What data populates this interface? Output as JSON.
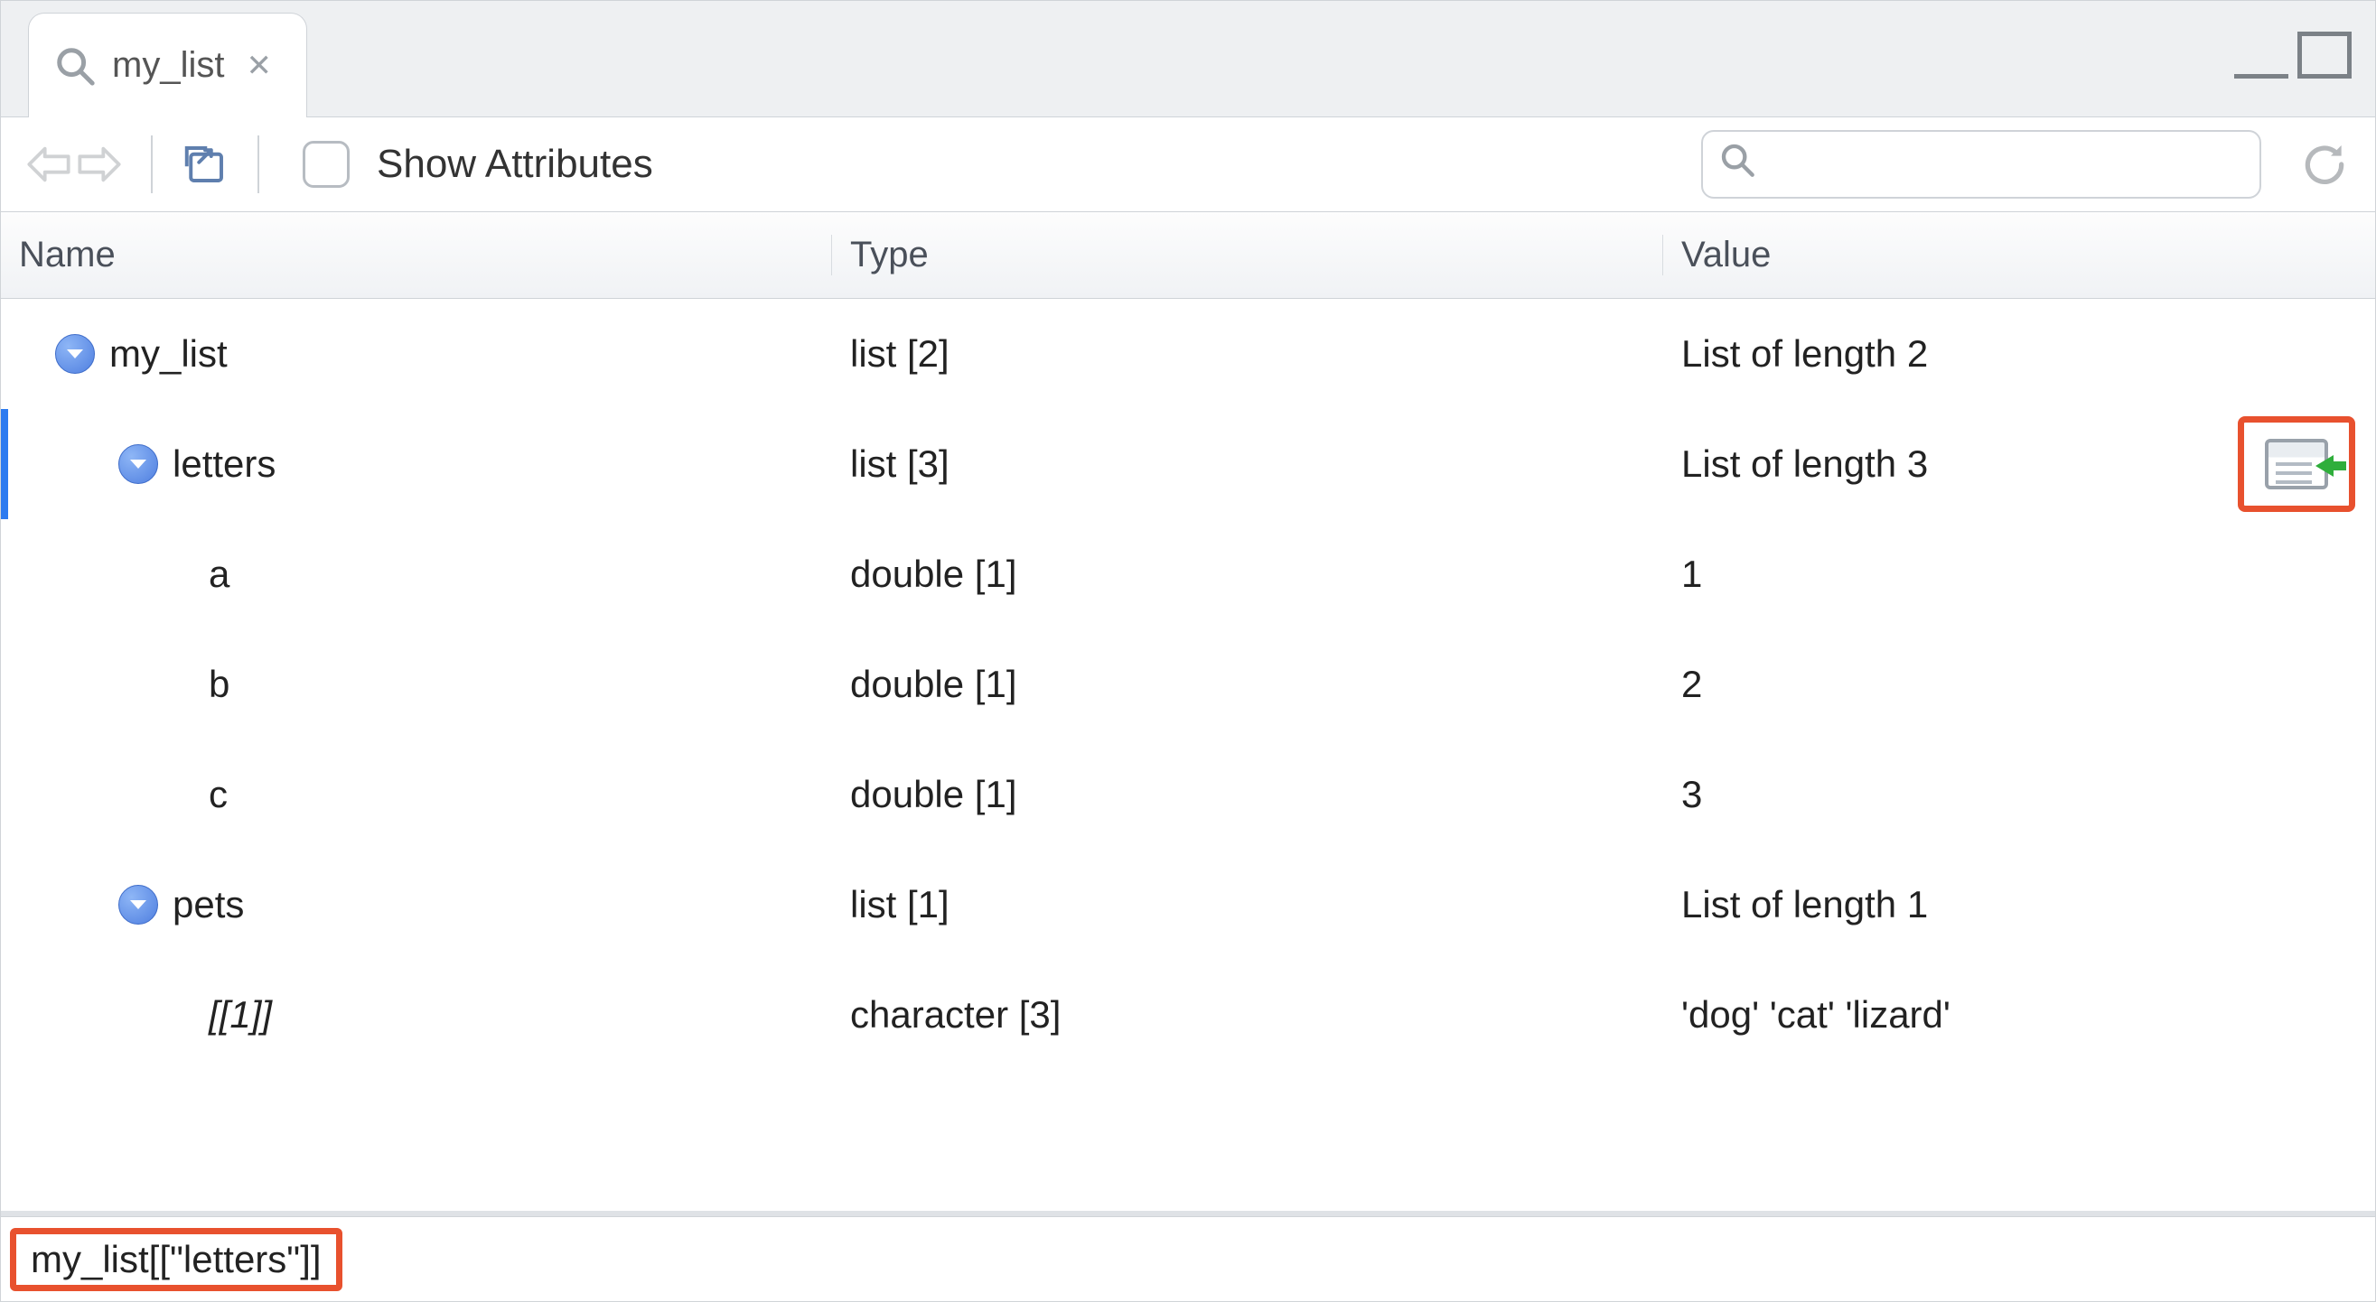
{
  "tab": {
    "title": "my_list"
  },
  "toolbar": {
    "show_attributes_label": "Show Attributes",
    "search_placeholder": ""
  },
  "columns": {
    "name": "Name",
    "type": "Type",
    "value": "Value"
  },
  "rows": [
    {
      "indent": 1,
      "expander": true,
      "name": "my_list",
      "type": "list [2]",
      "value": "List of length 2",
      "selected": false,
      "action_icon": false,
      "italic": false
    },
    {
      "indent": 2,
      "expander": true,
      "name": "letters",
      "type": "list [3]",
      "value": "List of length 3",
      "selected": true,
      "action_icon": true,
      "italic": false
    },
    {
      "indent": 3,
      "expander": false,
      "name": "a",
      "type": "double [1]",
      "value": "1",
      "selected": false,
      "action_icon": false,
      "italic": false
    },
    {
      "indent": 3,
      "expander": false,
      "name": "b",
      "type": "double [1]",
      "value": "2",
      "selected": false,
      "action_icon": false,
      "italic": false
    },
    {
      "indent": 3,
      "expander": false,
      "name": "c",
      "type": "double [1]",
      "value": "3",
      "selected": false,
      "action_icon": false,
      "italic": false
    },
    {
      "indent": 2,
      "expander": true,
      "name": "pets",
      "type": "list [1]",
      "value": "List of length 1",
      "selected": false,
      "action_icon": false,
      "italic": false
    },
    {
      "indent": 3,
      "expander": false,
      "name": "[[1]]",
      "type": "character [3]",
      "value": "'dog' 'cat' 'lizard'",
      "selected": false,
      "action_icon": false,
      "italic": true
    }
  ],
  "footer": {
    "path": "my_list[[\"letters\"]]"
  },
  "colors": {
    "highlight_border": "#e8512e",
    "selection_edge": "#2d7bf0",
    "expander_fill": "#4f7fe0"
  }
}
